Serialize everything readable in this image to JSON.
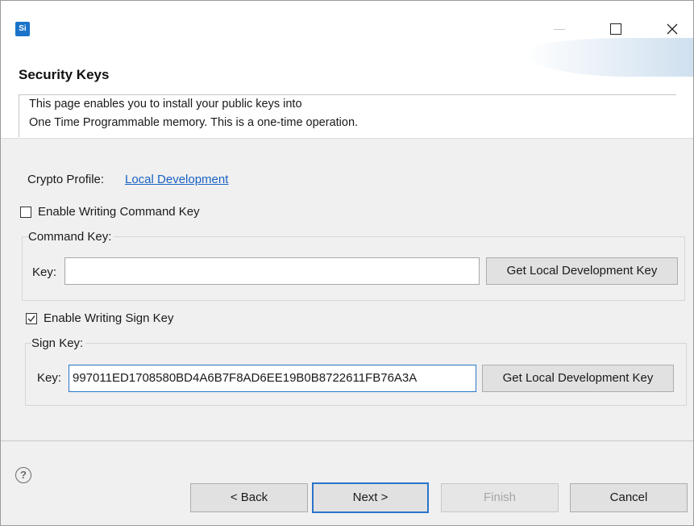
{
  "window": {
    "app_icon_text": "Si",
    "icons": {
      "minimize": "minimize-icon",
      "maximize": "maximize-icon",
      "close": "close-icon"
    }
  },
  "banner": {
    "title": "Security Keys",
    "description_line1": "This page enables you to install your public keys into",
    "description_line2": "One Time Programmable memory.  This is a one-time operation."
  },
  "crypto_profile": {
    "label": "Crypto Profile:",
    "value": "Local Development"
  },
  "command_key": {
    "enable_label": "Enable Writing Command Key",
    "enabled": false,
    "group_label": "Command Key:",
    "key_label": "Key:",
    "key_value": "",
    "button_label": "Get Local Development Key"
  },
  "sign_key": {
    "enable_label": "Enable Writing Sign Key",
    "enabled": true,
    "group_label": "Sign Key:",
    "key_label": "Key:",
    "key_value": "997011ED1708580BD4A6B7F8AD6EE19B0B8722611FB76A3A",
    "button_label": "Get Local Development Key"
  },
  "footer": {
    "help_icon": "help-icon",
    "help_glyph": "?",
    "back_label": "< Back",
    "next_label": "Next >",
    "finish_label": "Finish",
    "cancel_label": "Cancel"
  },
  "colors": {
    "accent": "#2a74c9",
    "link": "#1a62c4",
    "app_icon": "#1a73c8"
  }
}
